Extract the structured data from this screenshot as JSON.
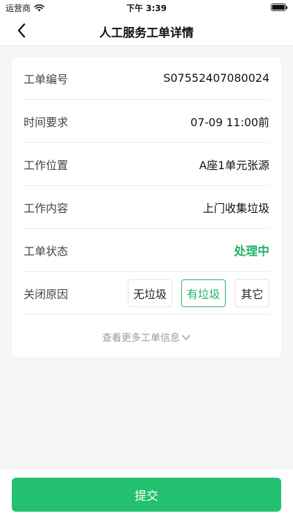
{
  "status_bar": {
    "carrier": "运营商",
    "time": "下午 3:39",
    "wifi_icon": "wifi-icon",
    "battery_icon": "battery-icon"
  },
  "nav": {
    "title": "人工服务工单详情",
    "back_icon": "chevron-left-icon"
  },
  "details": {
    "order_no_label": "工单编号",
    "order_no_value": "S07552407080024",
    "time_label": "时间要求",
    "time_value": "07-09 11:00前",
    "location_label": "工作位置",
    "location_value": "A座1单元张源",
    "content_label": "工作内容",
    "content_value": "上门收集垃圾",
    "status_label": "工单状态",
    "status_value": "处理中",
    "close_reason_label": "关闭原因",
    "close_reason_options": [
      "无垃圾",
      "有垃圾",
      "其它"
    ],
    "close_reason_selected": "有垃圾",
    "more_link": "查看更多工单信息"
  },
  "footer": {
    "submit_label": "提交"
  },
  "colors": {
    "accent": "#23b26b",
    "button": "#23c06f",
    "background": "#f6f6f7"
  }
}
